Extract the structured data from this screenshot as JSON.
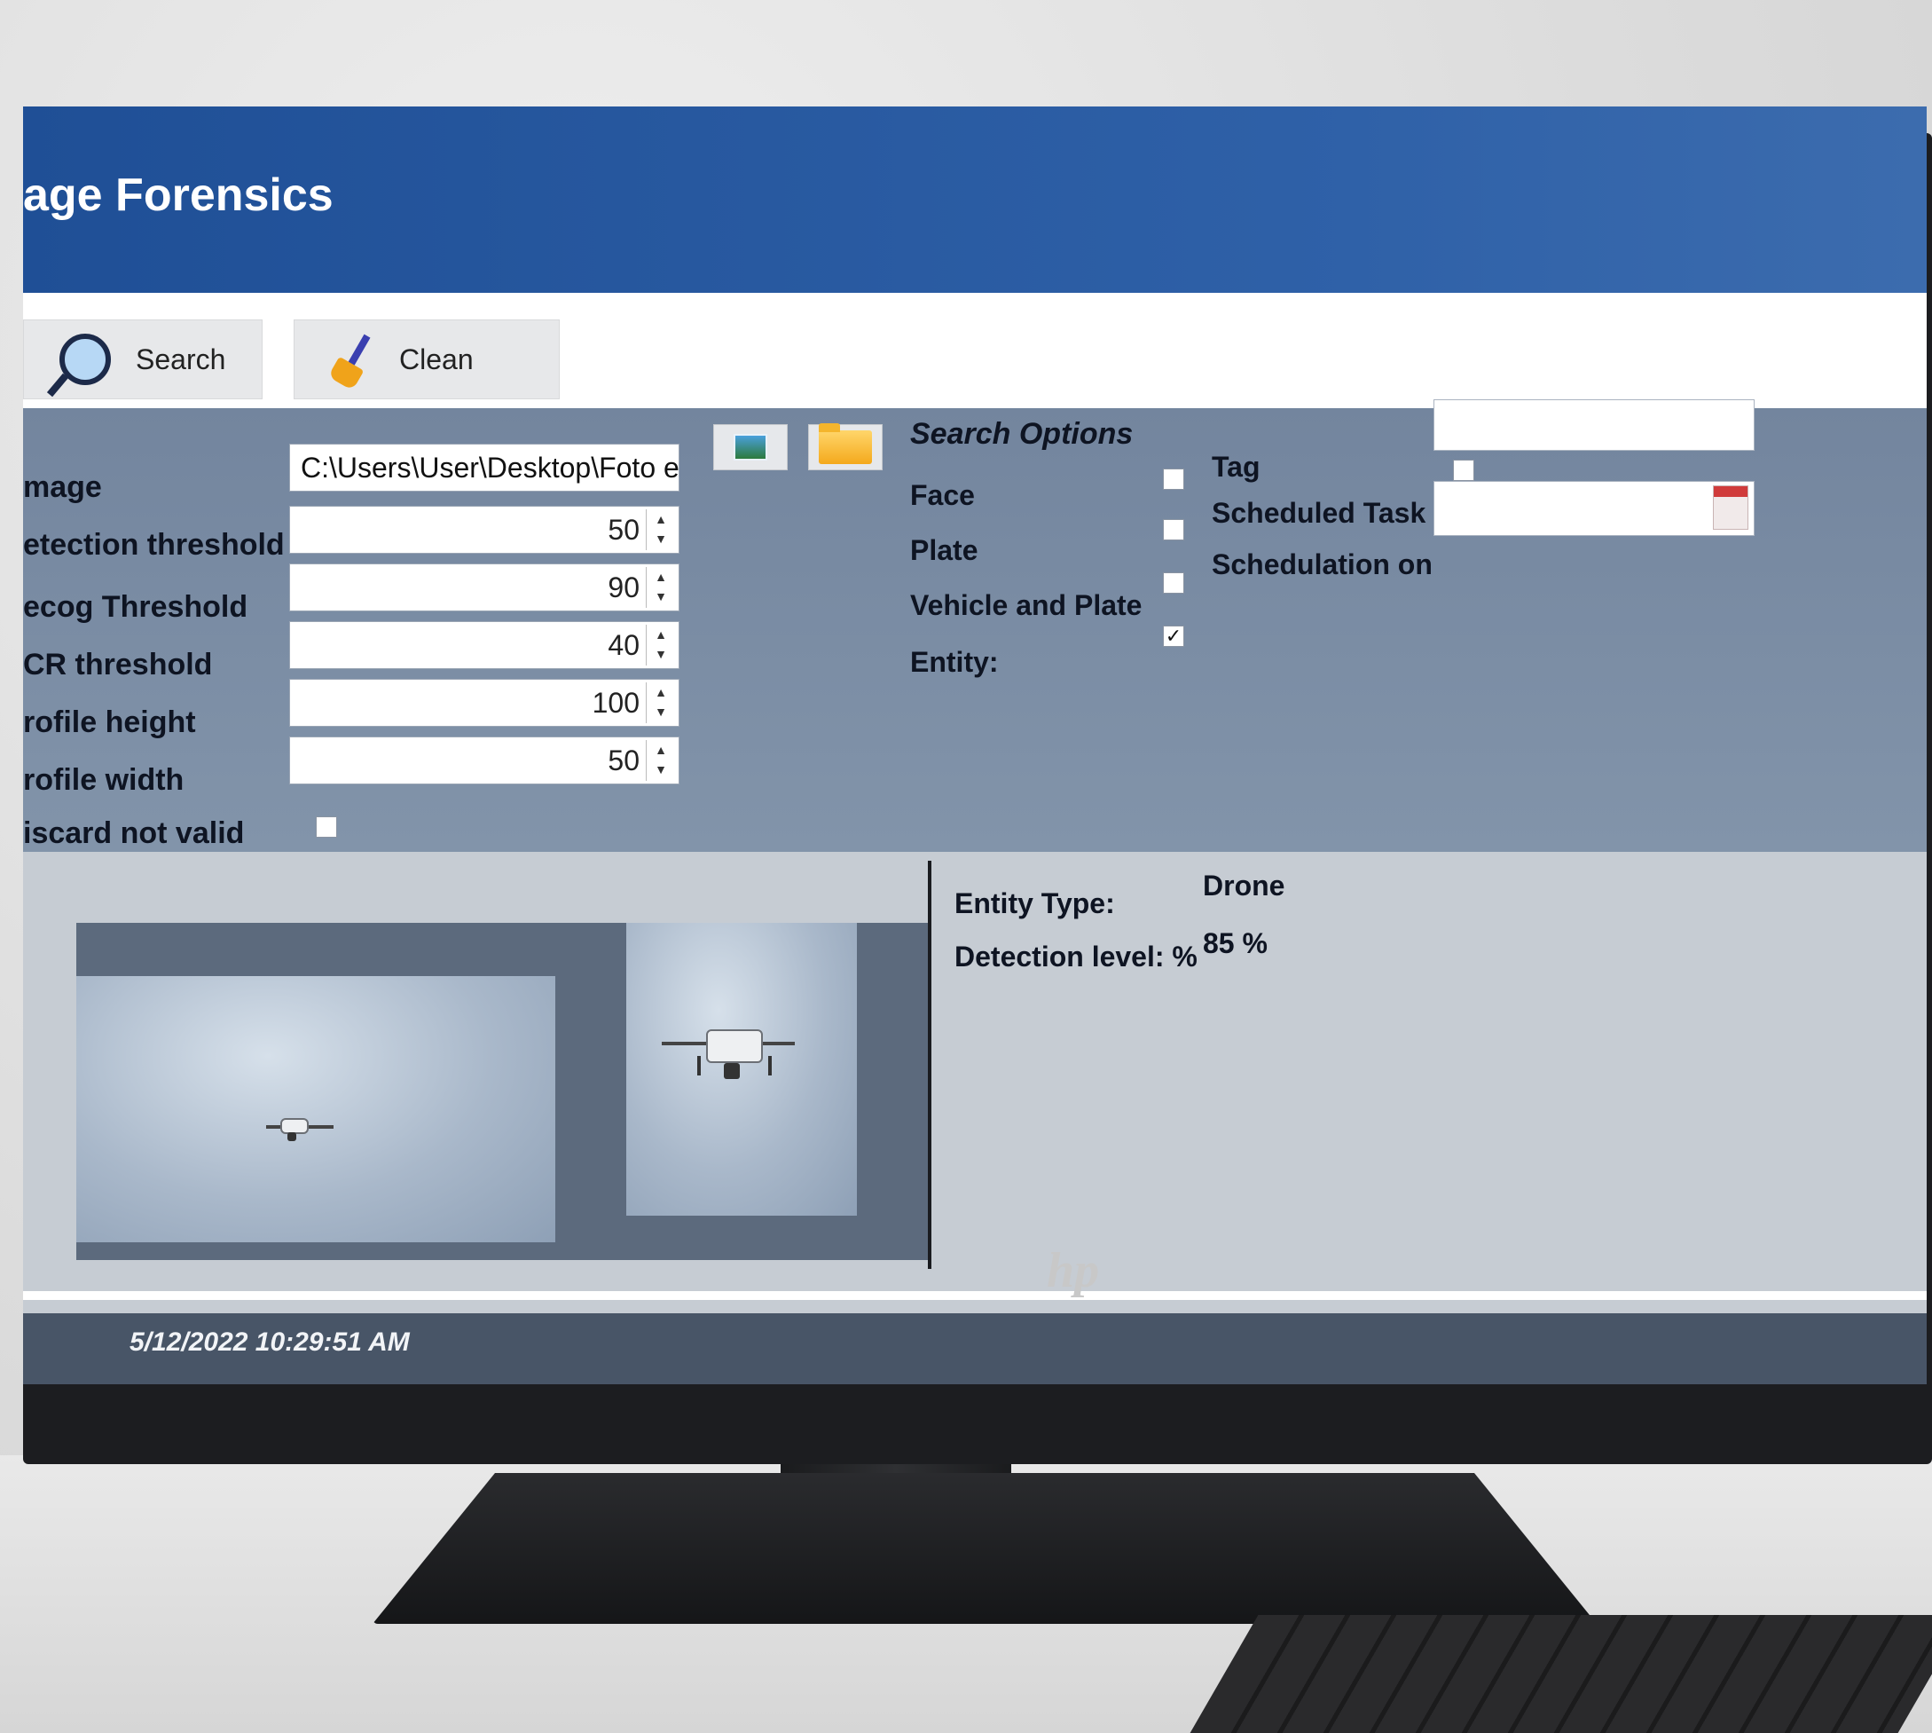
{
  "app": {
    "title": "age Forensics"
  },
  "toolbar": {
    "search_label": "Search",
    "clean_label": "Clean"
  },
  "form": {
    "image_label": "mage",
    "image_path": "C:\\Users\\User\\Desktop\\Foto e",
    "detection_threshold_label": "etection threshold",
    "detection_threshold_value": "50",
    "recog_threshold_label": "ecog Threshold",
    "recog_threshold_value": "90",
    "ocr_threshold_label": "CR threshold",
    "ocr_threshold_value": "40",
    "profile_height_label": "rofile height",
    "profile_height_value": "100",
    "profile_width_label": "rofile width",
    "profile_width_value": "50",
    "discard_label": "iscard not valid",
    "discard_checked": false
  },
  "search_options": {
    "title": "Search Options",
    "face_label": "Face",
    "face_checked": false,
    "plate_label": "Plate",
    "plate_checked": false,
    "vehicle_plate_label": "Vehicle and Plate",
    "vehicle_plate_checked": false,
    "entity_label": "Entity:",
    "entity_checked": true,
    "tag_label": "Tag",
    "tag_value": "",
    "scheduled_task_label": "Scheduled Task",
    "scheduled_task_checked": false,
    "schedulation_on_label": "Schedulation on",
    "schedulation_on_value": ""
  },
  "result": {
    "entity_type_label": "Entity Type:",
    "entity_type_value": "Drone",
    "detection_level_label": "Detection level: %",
    "detection_level_value": "85 %"
  },
  "status": {
    "timestamp": "5/12/2022 10:29:51 AM"
  },
  "monitor": {
    "brand": "hp"
  },
  "icons": {
    "search": "magnifier-icon",
    "clean": "broom-icon",
    "image_browse": "image-icon",
    "folder_browse": "folder-icon",
    "calendar": "calendar-icon"
  },
  "colors": {
    "title_bar": "#1f4f96",
    "panel": "#7a8ca3",
    "status_bar": "#485567"
  }
}
